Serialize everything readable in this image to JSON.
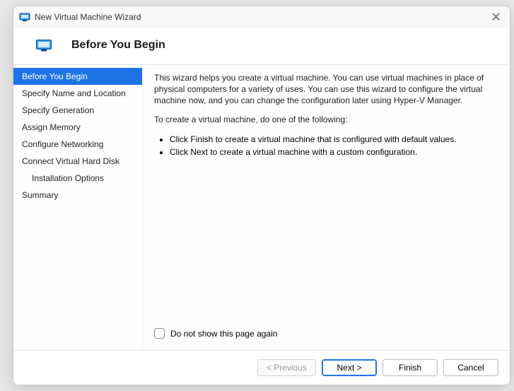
{
  "window": {
    "title": "New Virtual Machine Wizard"
  },
  "header": {
    "title": "Before You Begin"
  },
  "sidebar": {
    "items": [
      {
        "label": "Before You Begin",
        "active": true
      },
      {
        "label": "Specify Name and Location"
      },
      {
        "label": "Specify Generation"
      },
      {
        "label": "Assign Memory"
      },
      {
        "label": "Configure Networking"
      },
      {
        "label": "Connect Virtual Hard Disk"
      },
      {
        "label": "Installation Options",
        "sub": true
      },
      {
        "label": "Summary"
      }
    ]
  },
  "content": {
    "intro": "This wizard helps you create a virtual machine. You can use virtual machines in place of physical computers for a variety of uses. You can use this wizard to configure the virtual machine now, and you can change the configuration later using Hyper-V Manager.",
    "lead": "To create a virtual machine, do one of the following:",
    "bullets": [
      "Click Finish to create a virtual machine that is configured with default values.",
      "Click Next to create a virtual machine with a custom configuration."
    ],
    "checkbox_label": "Do not show this page again"
  },
  "footer": {
    "previous": "< Previous",
    "next": "Next >",
    "finish": "Finish",
    "cancel": "Cancel"
  }
}
